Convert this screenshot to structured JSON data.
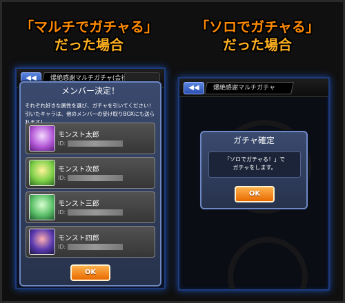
{
  "headings": {
    "left": {
      "line1": "「マルチでガチャる」",
      "line2": "だった場合"
    },
    "right": {
      "line1": "「ソロでガチャる」",
      "line2": "だった場合"
    }
  },
  "left_screen": {
    "topbar_title": "爆絶感謝マルチガチャ(会社)",
    "dialog": {
      "title": "メンバー決定！",
      "message_line1": "それぞれ好きな属性を選び、ガチャを引いてください！",
      "message_line2": "引いたキャラは、他のメンバーの受け取りBOXにも送られます！",
      "members": [
        {
          "name": "モンスト太郎",
          "id_label": "ID:"
        },
        {
          "name": "モンスト次郎",
          "id_label": "ID:"
        },
        {
          "name": "モンスト三郎",
          "id_label": "ID:"
        },
        {
          "name": "モンスト四郎",
          "id_label": "ID:"
        }
      ],
      "ok_label": "OK"
    }
  },
  "right_screen": {
    "back_icon": "double-left-arrow-icon",
    "topbar_title": "爆絶感謝マルチガチャ",
    "dialog": {
      "title": "ガチャ確定",
      "message_line1": "「ソロでガチャる！」で",
      "message_line2": "ガチャをします。",
      "ok_label": "OK"
    }
  },
  "colors": {
    "heading": "#ff8a00",
    "dialog_bg": "#2f3b5a",
    "ok_button": "#f08a1e",
    "screen_glow": "#1b4aa8"
  }
}
